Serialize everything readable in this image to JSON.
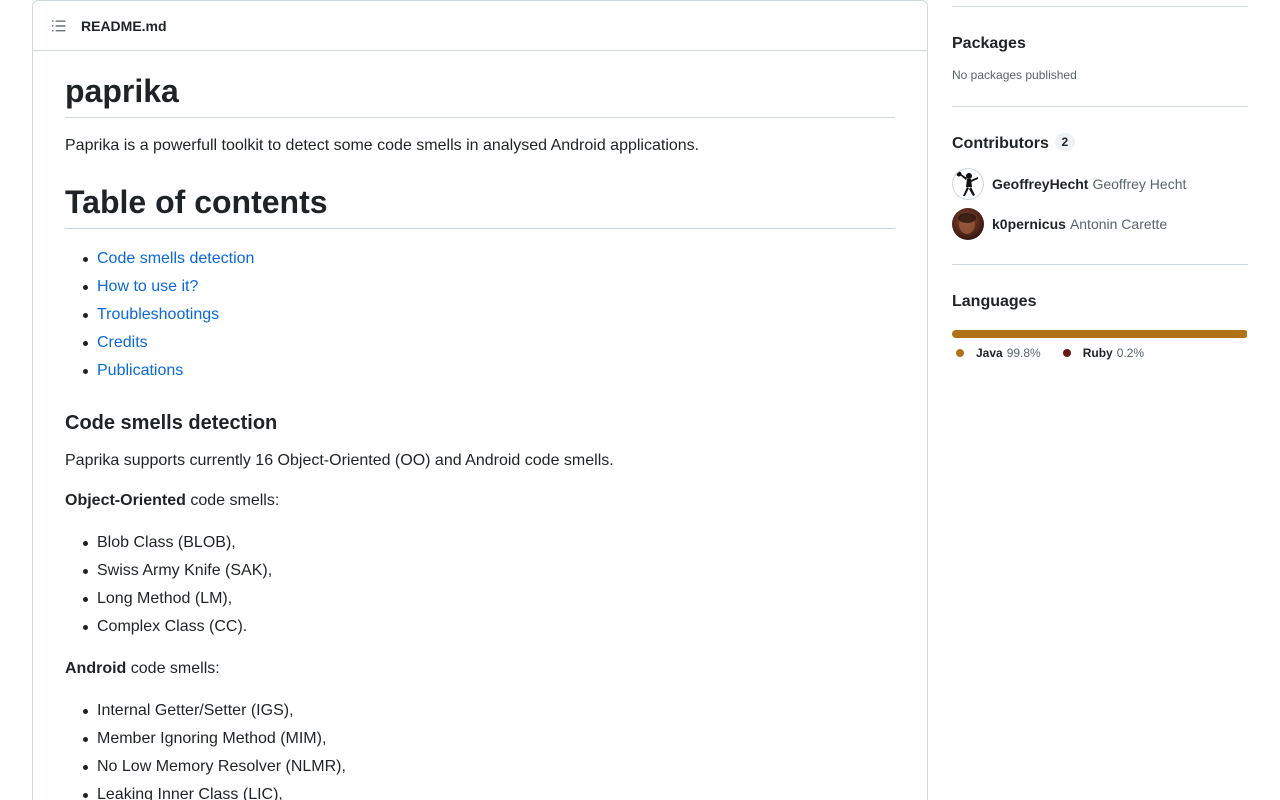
{
  "readme": {
    "filename": "README.md",
    "title": "paprika",
    "intro": "Paprika is a powerfull toolkit to detect some code smells in analysed Android applications.",
    "toc_heading": "Table of contents",
    "toc": [
      "Code smells detection",
      "How to use it?",
      "Troubleshootings",
      "Credits",
      "Publications"
    ],
    "section_heading": "Code smells detection",
    "section_intro": "Paprika supports currently 16 Object-Oriented (OO) and Android code smells.",
    "oo_label_bold": "Object-Oriented",
    "oo_label_rest": " code smells:",
    "oo_smells": [
      "Blob Class (BLOB),",
      "Swiss Army Knife (SAK),",
      "Long Method (LM),",
      "Complex Class (CC)."
    ],
    "android_label_bold": "Android",
    "android_label_rest": " code smells:",
    "android_smells": [
      "Internal Getter/Setter (IGS),",
      "Member Ignoring Method (MIM),",
      "No Low Memory Resolver (NLMR),",
      "Leaking Inner Class (LIC),"
    ]
  },
  "sidebar": {
    "packages": {
      "title": "Packages",
      "note": "No packages published"
    },
    "contributors": {
      "title": "Contributors",
      "count": "2",
      "people": [
        {
          "login": "GeoffreyHecht",
          "name": "Geoffrey Hecht"
        },
        {
          "login": "k0pernicus",
          "name": "Antonin Carette"
        }
      ]
    },
    "languages": {
      "title": "Languages",
      "items": [
        {
          "name": "Java",
          "percent": "99.8%",
          "value": 99.8,
          "color": "#b07219"
        },
        {
          "name": "Ruby",
          "percent": "0.2%",
          "value": 0.2,
          "color": "#701516"
        }
      ]
    }
  }
}
